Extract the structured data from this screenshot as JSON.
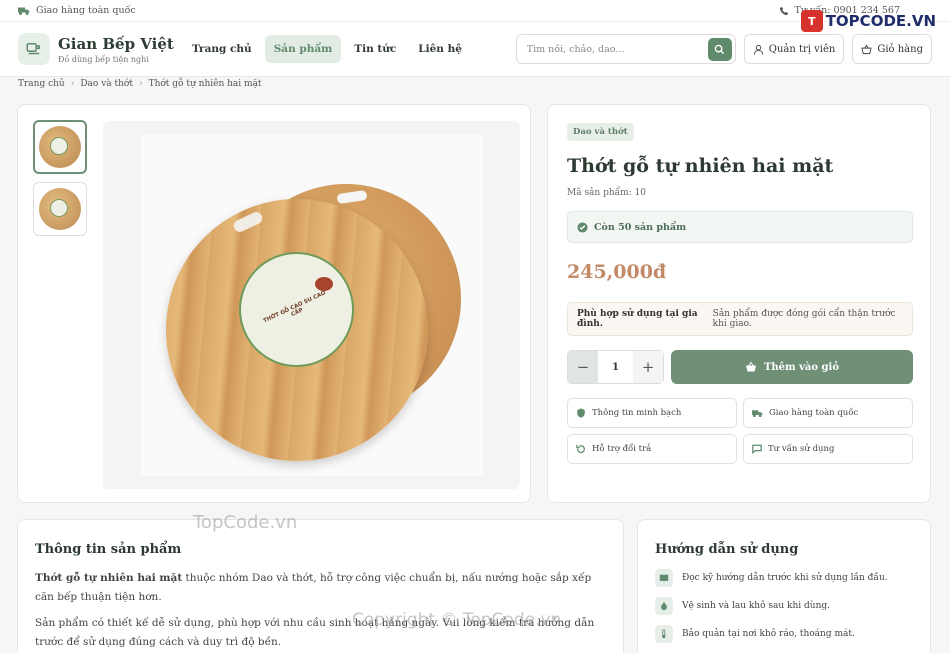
{
  "topbar": {
    "shipping": "Giao hàng toàn quốc",
    "hotline": "Tư vấn: 0901 234 567"
  },
  "brand_watermark": "TOPCODE.VN",
  "header": {
    "site_name": "Gian Bếp Việt",
    "tagline": "Đồ dùng bếp tiện nghi",
    "nav": [
      {
        "label": "Trang chủ",
        "active": false
      },
      {
        "label": "Sản phẩm",
        "active": true
      },
      {
        "label": "Tin tức",
        "active": false
      },
      {
        "label": "Liên hệ",
        "active": false
      }
    ],
    "search_placeholder": "Tìm nồi, chảo, dao...",
    "admin_label": "Quản trị viên",
    "cart_label": "Giỏ hàng"
  },
  "breadcrumb": [
    "Trang chủ",
    "Dao và thớt",
    "Thớt gỗ tự nhiên hai mặt"
  ],
  "product": {
    "category": "Dao và thớt",
    "title": "Thớt gỗ tự nhiên hai mặt",
    "sku": "Mã sản phẩm: 10",
    "stock": "Còn 50 sản phẩm",
    "price": "245,000đ",
    "note_bold": "Phù hợp sử dụng tại gia đình.",
    "note_text": "Sản phẩm được đóng gói cẩn thận trước khi giao.",
    "qty": "1",
    "add_to_cart": "Thêm vào giỏ",
    "image_label": "THỚT GỖ CAO SU CAO CẤP",
    "features": [
      "Thông tin minh bạch",
      "Giao hàng toàn quốc",
      "Hỗ trợ đổi trả",
      "Tư vấn sử dụng"
    ]
  },
  "description": {
    "title": "Thông tin sản phẩm",
    "p1_bold": "Thớt gỗ tự nhiên hai mặt",
    "p1_rest": " thuộc nhóm Dao và thớt, hỗ trợ công việc chuẩn bị, nấu nướng hoặc sắp xếp căn bếp thuận tiện hơn.",
    "p2": "Sản phẩm có thiết kế dễ sử dụng, phù hợp với nhu cầu sinh hoạt hằng ngày. Vui lòng kiểm tra hướng dẫn trước để sử dụng đúng cách và duy trì độ bền."
  },
  "guide": {
    "title": "Hướng dẫn sử dụng",
    "items": [
      "Đọc kỹ hướng dẫn trước khi sử dụng lần đầu.",
      "Vệ sinh và lau khô sau khi dùng.",
      "Bảo quản tại nơi khô ráo, thoáng mát."
    ]
  },
  "watermarks": {
    "mid": "TopCode.vn",
    "bottom": "Copyright © TopCode.vn"
  },
  "colors": {
    "accent": "#6f8f77",
    "price": "#c28a67",
    "bg": "#f6f6f4"
  }
}
